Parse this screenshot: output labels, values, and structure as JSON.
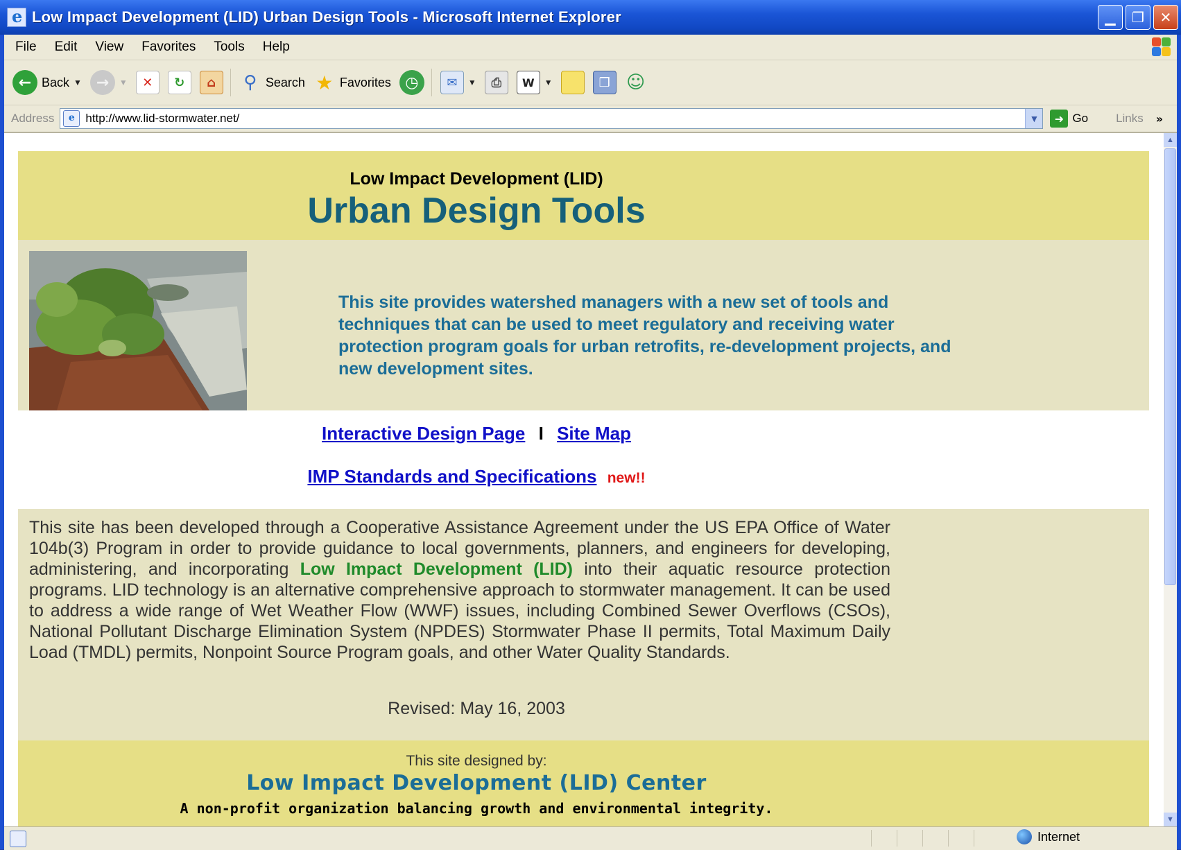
{
  "window": {
    "title": "Low Impact Development (LID) Urban Design Tools - Microsoft Internet Explorer"
  },
  "menu": [
    "File",
    "Edit",
    "View",
    "Favorites",
    "Tools",
    "Help"
  ],
  "toolbar": {
    "back_label": "Back",
    "search_label": "Search",
    "favorites_label": "Favorites"
  },
  "address": {
    "label": "Address",
    "url": "http://www.lid-stormwater.net/",
    "go_label": "Go",
    "links_label": "Links"
  },
  "page": {
    "header_small": "Low Impact Development (LID)",
    "header_big": "Urban Design Tools",
    "intro": "This site provides watershed managers with a new set of tools and techniques that can be used to meet regulatory and receiving water protection program goals for urban retrofits, re-development projects, and new development sites.",
    "link_interactive": "Interactive Design Page",
    "link_separator": "I",
    "link_sitemap": "Site Map",
    "link_imp": "IMP Standards and Specifications",
    "new_tag": "new!!",
    "body_part1": "This site has been developed through a Cooperative Assistance Agreement under the US EPA Office of Water 104b(3) Program in order to provide guidance to local governments, planners, and engineers for developing, administering, and incorporating ",
    "body_highlight": "Low Impact Development (LID)",
    "body_part2": " into their aquatic resource protection programs. LID technology is an alternative comprehensive approach to stormwater management. It can be used to address a wide range of Wet Weather Flow (WWF) issues, including Combined Sewer Overflows (CSOs), National Pollutant Discharge Elimination System (NPDES) Stormwater Phase II permits, Total Maximum Daily Load (TMDL) permits, Nonpoint Source Program goals, and other Water Quality Standards.",
    "revised": "Revised: May 16, 2003",
    "footer_small": "This site designed by:",
    "footer_big": "Low Impact Development (LID) Center",
    "footer_tagline": "A non-profit organization balancing growth and environmental integrity."
  },
  "status": {
    "zone": "Internet"
  },
  "colors": {
    "header_band": "#e6df86",
    "content_band": "#e6e3c3",
    "title_teal": "#16607a",
    "intro_blue": "#1b6d97",
    "link_blue": "#1010c8",
    "new_red": "#e01818",
    "highlight_green": "#1f8a2a"
  }
}
